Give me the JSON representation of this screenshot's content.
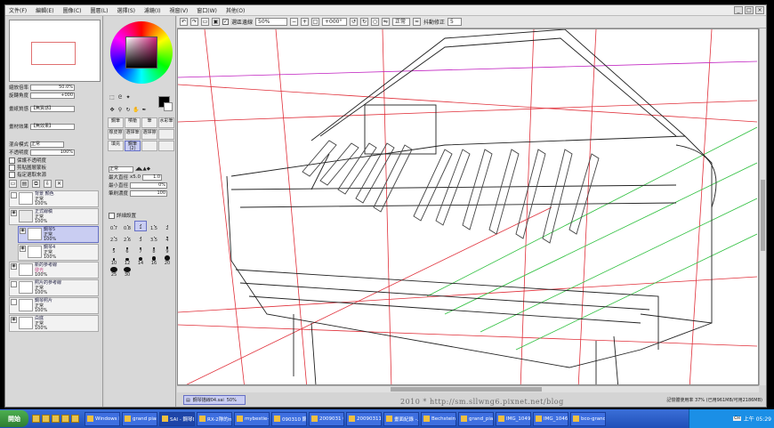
{
  "menu": [
    "文件(F)",
    "編輯(E)",
    "圖像(C)",
    "圖層(L)",
    "選擇(S)",
    "濾鏡(I)",
    "視窗(V)",
    "窗口(W)",
    "其他(O)"
  ],
  "toolbar": {
    "checkbox_label": "選區邊線",
    "zoom": "50%",
    "rotation": "+000°",
    "mode": "正常",
    "correction_label": "抖動修正",
    "correction_value": "5"
  },
  "left": {
    "zoom_label": "縮放倍率",
    "zoom_value": "50.0%",
    "angle_label": "旋轉角度",
    "angle_value": "+000",
    "texture_label": "畫紙質感",
    "texture_value": "【無質感】",
    "effect_label": "畫材效果",
    "effect_value": "【無效果】",
    "blend_label": "混合模式",
    "blend_value": "正常",
    "opacity_label": "不透明度",
    "opacity_value": "100%",
    "preserve_label": "保護不透明度",
    "clip_label": "剪貼圖層蒙板",
    "select_label": "指定選取來源"
  },
  "layers": [
    {
      "name": "背景 顏色",
      "mode": "正常",
      "opacity": "100%"
    },
    {
      "name": "正式線稿",
      "mode": "正常",
      "opacity": "100%"
    },
    {
      "name": "鋼琴5",
      "mode": "正常",
      "opacity": "100%"
    },
    {
      "name": "鋼琴4",
      "mode": "正常",
      "opacity": "100%"
    },
    {
      "name": "新的參考線",
      "mode": "發光",
      "opacity": "100%"
    },
    {
      "name": "照片的參考線",
      "mode": "正常",
      "opacity": "100%"
    },
    {
      "name": "鋼琴照片",
      "mode": "正常",
      "opacity": "100%"
    },
    {
      "name": "白底",
      "mode": "正常",
      "opacity": "100%"
    }
  ],
  "brushes": [
    "鋼筆",
    "噴槍",
    "筆",
    "水彩筆",
    "橡皮擦",
    "選擇筆",
    "選擇擦",
    "",
    "填充",
    "鋼筆(2)",
    "",
    ""
  ],
  "brush_settings": {
    "mode": "正常",
    "max_label": "最大直徑",
    "max_multiplier": "x5.0",
    "max_value": "1.0",
    "min_label": "最小直徑",
    "min_value": "0%",
    "density_label": "筆刷濃度",
    "density_value": "100",
    "detail_label": "詳細設置"
  },
  "sizes": [
    "0.7",
    "0.8",
    "1",
    "1.5",
    "2",
    "2.3",
    "2.6",
    "3",
    "3.5",
    "4",
    "5",
    "6",
    "7",
    "8",
    "9",
    "10",
    "12",
    "14",
    "16",
    "20",
    "25",
    "30"
  ],
  "doc_tab": {
    "name": "鋼琴描線04.sai",
    "zoom": "50%"
  },
  "memory": "記憶體使用率 37% (已用961MB/可用2186MB)",
  "watermark": "2010 * http://sm.sllwng6.pixnet.net/blog",
  "taskbar": {
    "start": "開始",
    "tasks": [
      "Windows M...",
      "grand piano...",
      "SAI - 鋼琴Do...",
      "RX-2隊的ma...",
      "mybestie-kin...",
      "090310 鋼琴",
      "2009031 0...",
      "20090311 0...",
      "畫面紀錄 -...",
      "Bechstein_0...",
      "grand_piano...",
      "IMG_1049 -...",
      "IMG_1046 -...",
      "bco-grand5..."
    ],
    "clock": "上午 05:29",
    "lang": "CH"
  },
  "colors": {
    "accent": "#6670c4",
    "guide_red": "#e0303a",
    "guide_green": "#30c040",
    "guide_magenta": "#c020c0"
  }
}
